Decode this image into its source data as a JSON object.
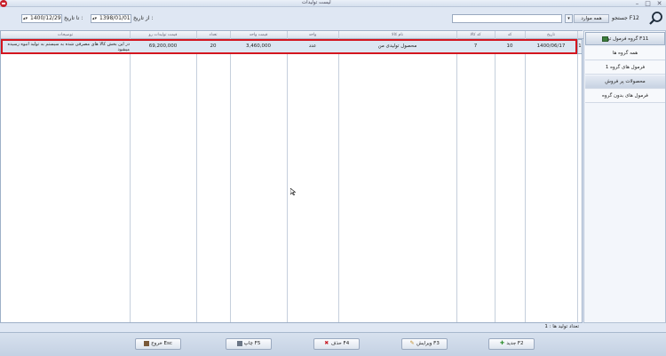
{
  "window": {
    "title": "لیست تولیدات"
  },
  "toolbar": {
    "from_date_label": "از تاریخ :",
    "from_date_value": "1398/01/01",
    "to_date_label": "تا تاریخ :",
    "to_date_value": "1400/12/29",
    "search_placeholder": "",
    "search_field_value": "همه موارد",
    "search_label": "جستجو F12"
  },
  "grid": {
    "columns": [
      "تاریخ",
      "کد",
      "کد کالا",
      "نام کالا",
      "واحد",
      "قیمت واحد",
      "تعداد",
      "قیمت تولیدات رو",
      "توضیحات"
    ],
    "rows": [
      {
        "index": "1",
        "date": "1400/06/17",
        "code": "10",
        "item_code": "7",
        "item_name": "محصول تولیدی من",
        "unit": "عدد",
        "unit_price": "3,460,000",
        "quantity": "20",
        "total": "69,200,000",
        "description": "در این بخش کالا های مصرفی شده به سیستم به تولید انبوه رسیده میشود"
      }
    ]
  },
  "panel": {
    "header": "گروه فرمول تولید F11",
    "items": [
      "همه گروه ها",
      "فرمول های گروه 1",
      "محصولات پر فروش",
      "فرمول های بدون گروه"
    ]
  },
  "footer": {
    "count_text": "تعداد تولید ها : 1"
  },
  "buttons": {
    "exit": "خروج Esc",
    "print": "چاپ F5",
    "delete": "حذف F4",
    "edit": "ویرایش F3",
    "new": "جدید F2"
  },
  "colors": {
    "selection_border": "#d4161f",
    "accent_icon": "#c8202a"
  }
}
